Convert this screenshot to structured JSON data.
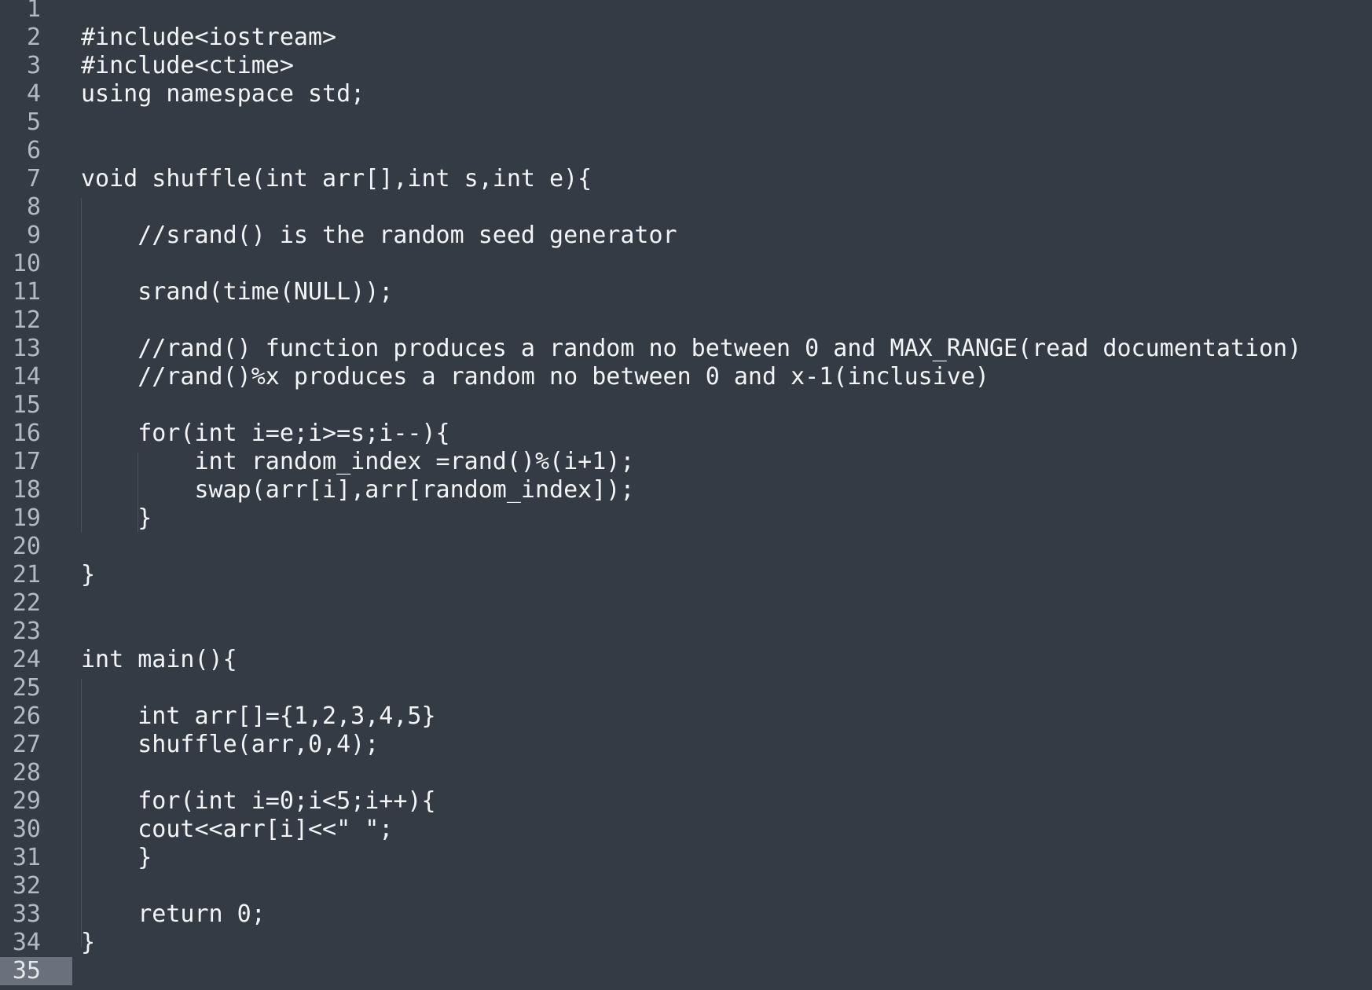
{
  "editor": {
    "active_line": 35,
    "lines": [
      {
        "num": "1",
        "text": ""
      },
      {
        "num": "2",
        "text": "#include<iostream>"
      },
      {
        "num": "3",
        "text": "#include<ctime>"
      },
      {
        "num": "4",
        "text": "using namespace std;"
      },
      {
        "num": "5",
        "text": ""
      },
      {
        "num": "6",
        "text": ""
      },
      {
        "num": "7",
        "text": "void shuffle(int arr[],int s,int e){"
      },
      {
        "num": "8",
        "text": ""
      },
      {
        "num": "9",
        "text": "    //srand() is the random seed generator"
      },
      {
        "num": "10",
        "text": ""
      },
      {
        "num": "11",
        "text": "    srand(time(NULL));"
      },
      {
        "num": "12",
        "text": ""
      },
      {
        "num": "13",
        "text": "    //rand() function produces a random no between 0 and MAX_RANGE(read documentation)"
      },
      {
        "num": "14",
        "text": "    //rand()%x produces a random no between 0 and x-1(inclusive)"
      },
      {
        "num": "15",
        "text": ""
      },
      {
        "num": "16",
        "text": "    for(int i=e;i>=s;i--){"
      },
      {
        "num": "17",
        "text": "        int random_index =rand()%(i+1);"
      },
      {
        "num": "18",
        "text": "        swap(arr[i],arr[random_index]);"
      },
      {
        "num": "19",
        "text": "    }"
      },
      {
        "num": "20",
        "text": ""
      },
      {
        "num": "21",
        "text": "}"
      },
      {
        "num": "22",
        "text": ""
      },
      {
        "num": "23",
        "text": ""
      },
      {
        "num": "24",
        "text": "int main(){"
      },
      {
        "num": "25",
        "text": ""
      },
      {
        "num": "26",
        "text": "    int arr[]={1,2,3,4,5}"
      },
      {
        "num": "27",
        "text": "    shuffle(arr,0,4);"
      },
      {
        "num": "28",
        "text": ""
      },
      {
        "num": "29",
        "text": "    for(int i=0;i<5;i++){"
      },
      {
        "num": "30",
        "text": "    cout<<arr[i]<<\" \";"
      },
      {
        "num": "31",
        "text": "    }"
      },
      {
        "num": "32",
        "text": ""
      },
      {
        "num": "33",
        "text": "    return 0;"
      },
      {
        "num": "34",
        "text": "}"
      },
      {
        "num": "35",
        "text": ""
      }
    ]
  }
}
